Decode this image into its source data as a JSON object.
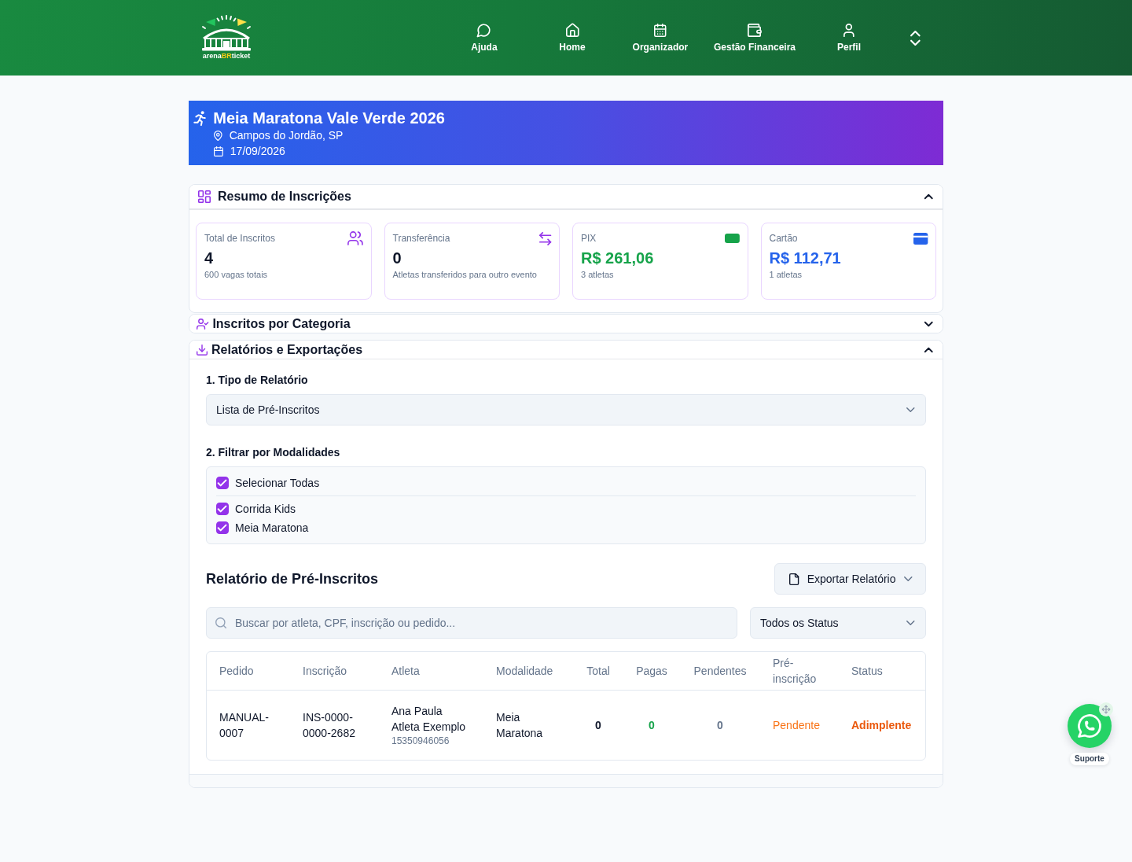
{
  "header": {
    "logo": [
      {
        "text": "arena",
        "kind": "plain"
      },
      {
        "text": "BR",
        "kind": "accent"
      },
      {
        "text": "ticket",
        "kind": "plain"
      }
    ],
    "nav": [
      {
        "label": "Ajuda"
      },
      {
        "label": "Home"
      },
      {
        "label": "Organizador"
      },
      {
        "label": "Gestão Financeira"
      },
      {
        "label": "Perfil"
      }
    ]
  },
  "event": {
    "title": "Meia Maratona Vale Verde 2026",
    "location": "Campos do Jordão, SP",
    "date": "17/09/2026"
  },
  "summary": {
    "title": "Resumo de Inscrições",
    "expanded": true,
    "cards": [
      {
        "label": "Total de Inscritos",
        "value": "4",
        "note": "600 vagas totais",
        "color": "#0f172a"
      },
      {
        "label": "Transferência",
        "value": "0",
        "note": "Atletas transferidos para outro evento",
        "color": "#0f172a"
      },
      {
        "label": "PIX",
        "value": "R$ 261,06",
        "note": "3 atletas",
        "color": "#16a34a"
      },
      {
        "label": "Cartão",
        "value": "R$ 112,71",
        "note": "1 atletas",
        "color": "#2563eb"
      }
    ]
  },
  "categories": {
    "title": "Inscritos por Categoria",
    "expanded": false
  },
  "reports": {
    "title": "Relatórios e Exportações",
    "expanded": true,
    "report_type": {
      "label": "1. Tipo de Relatório",
      "value": "Lista de Pré-Inscritos"
    },
    "modality_filter": {
      "label": "2. Filtrar por Modalidades",
      "select_all": {
        "label": "Selecionar Todas",
        "checked": true
      },
      "options": [
        {
          "label": "Corrida Kids",
          "checked": true
        },
        {
          "label": "Meia Maratona",
          "checked": true
        }
      ]
    },
    "report": {
      "title": "Relatório de Pré-Inscritos",
      "export_button": "Exportar Relatório",
      "search": {
        "placeholder": "Buscar por atleta, CPF, inscrição ou pedido..."
      },
      "status_filter": "Todos os Status",
      "table": {
        "columns": [
          "Pedido",
          "Inscrição",
          "Atleta",
          "Modalidade",
          "Total",
          "Pagas",
          "Pendentes",
          "Pré-inscrição",
          "Status"
        ],
        "rows": [
          {
            "cells": [
              {
                "text": "MANUAL-0007"
              },
              {
                "text": "INS-0000-0000-2682"
              },
              {
                "text": "Ana Paula Atleta Exemplo",
                "sub": "15350946056"
              },
              {
                "text": "Meia Maratona"
              },
              {
                "text": "0"
              },
              {
                "text": "0",
                "color": "#16a34a"
              },
              {
                "text": "0",
                "color": "#64748b"
              },
              {
                "text": "Pendente",
                "color": "#f97316"
              },
              {
                "text": "Adimplente",
                "color": "#ea580c"
              }
            ]
          }
        ]
      }
    }
  },
  "support": {
    "label": "Suporte"
  }
}
